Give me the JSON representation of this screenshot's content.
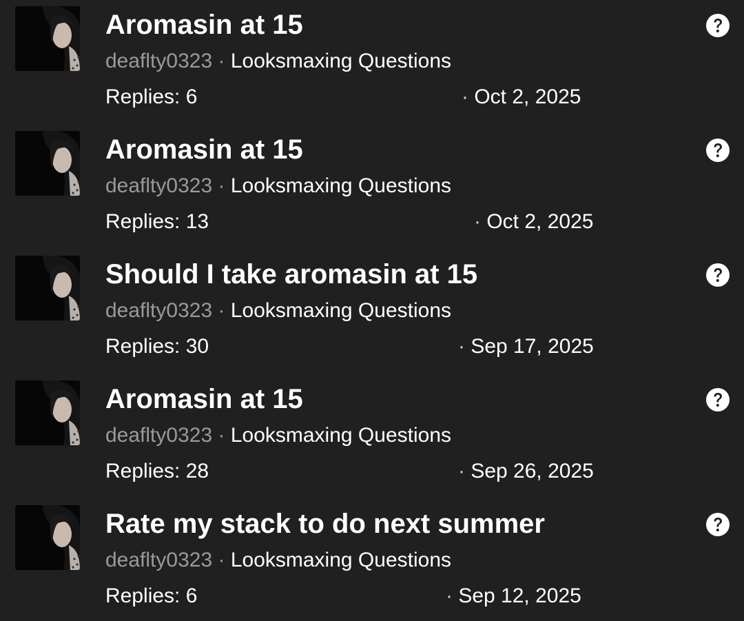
{
  "threads": [
    {
      "title": "Aromasin at 15",
      "author": "deaflty0323",
      "separator": "·",
      "forum": "Looksmaxing Questions",
      "replies": "Replies: 6",
      "date_dot": "·",
      "date": "Oct 2, 2025",
      "status_icon": "question-circle-icon"
    },
    {
      "title": "Aromasin at 15",
      "author": "deaflty0323",
      "separator": "·",
      "forum": "Looksmaxing Questions",
      "replies": "Replies: 13",
      "date_dot": "·",
      "date": "Oct 2, 2025",
      "status_icon": "question-circle-icon"
    },
    {
      "title": "Should I take aromasin at 15",
      "author": "deaflty0323",
      "separator": "·",
      "forum": "Looksmaxing Questions",
      "replies": "Replies: 30",
      "date_dot": "·",
      "date": "Sep 17, 2025",
      "status_icon": "question-circle-icon"
    },
    {
      "title": "Aromasin at 15",
      "author": "deaflty0323",
      "separator": "·",
      "forum": "Looksmaxing Questions",
      "replies": "Replies: 28",
      "date_dot": "·",
      "date": "Sep 26, 2025",
      "status_icon": "question-circle-icon"
    },
    {
      "title": "Rate my stack to do next summer",
      "author": "deaflty0323",
      "separator": "·",
      "forum": "Looksmaxing Questions",
      "replies": "Replies: 6",
      "date_dot": "·",
      "date": "Sep 12, 2025",
      "status_icon": "question-circle-icon"
    }
  ],
  "colors": {
    "background": "#202020",
    "text_primary": "#ffffff",
    "text_muted": "#9a9a9a"
  }
}
